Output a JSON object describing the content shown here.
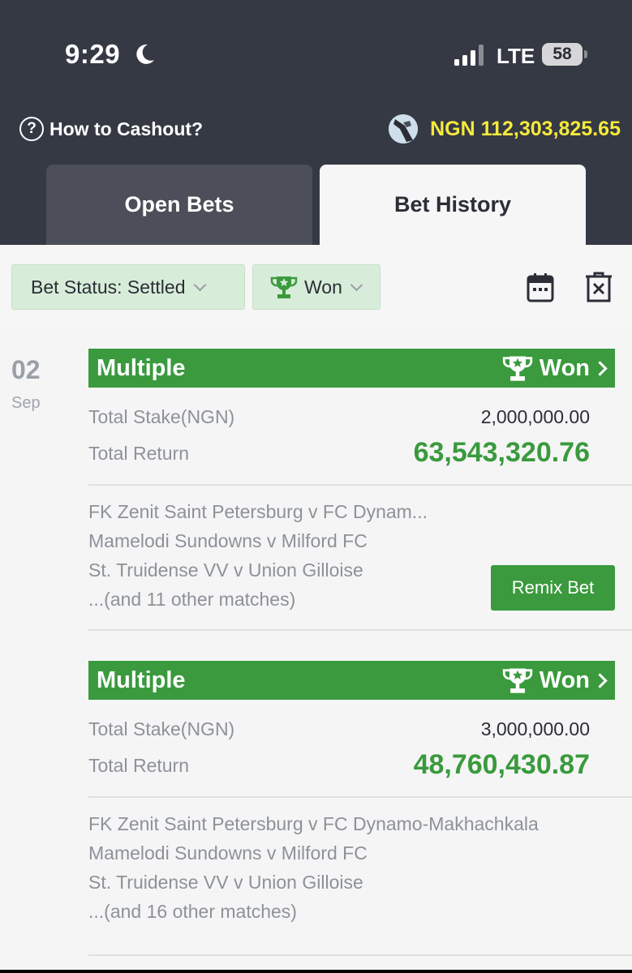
{
  "status_bar": {
    "time": "9:29",
    "network": "LTE",
    "battery": "58"
  },
  "header": {
    "help_label": "How to Cashout?",
    "balance": "NGN 112,303,825.65"
  },
  "tabs": [
    {
      "label": "Open Bets",
      "active": false
    },
    {
      "label": "Bet History",
      "active": true
    }
  ],
  "filters": {
    "status_label": "Bet Status: Settled",
    "result_label": "Won"
  },
  "date_group": {
    "day": "02",
    "month": "Sep"
  },
  "bets": [
    {
      "type": "Multiple",
      "result": "Won",
      "stake_label": "Total Stake(NGN)",
      "stake": "2,000,000.00",
      "return_label": "Total Return",
      "total_return": "63,543,320.76",
      "matches": [
        "FK Zenit Saint Petersburg v FC Dynam...",
        "Mamelodi Sundowns v Milford FC",
        "St. Truidense VV v Union Gilloise",
        "...(and 11 other matches)"
      ],
      "action_label": "Remix Bet"
    },
    {
      "type": "Multiple",
      "result": "Won",
      "stake_label": "Total Stake(NGN)",
      "stake": "3,000,000.00",
      "return_label": "Total Return",
      "total_return": "48,760,430.87",
      "matches": [
        "FK Zenit Saint Petersburg v FC Dynamo-Makhachkala",
        "Mamelodi Sundowns v Milford FC",
        "St. Truidense VV v Union Gilloise",
        "...(and 16 other matches)"
      ]
    }
  ],
  "colors": {
    "header_bg": "#353944",
    "accent_green": "#3a9a3d",
    "balance_yellow": "#f5ea3c",
    "chip_bg": "#d8edd9"
  },
  "icons": [
    "moon-icon",
    "signal-icon",
    "battery-icon",
    "help-circle-icon",
    "avatar",
    "trophy-icon",
    "chevron-down-icon",
    "calendar-icon",
    "clear-filter-icon",
    "chevron-right-icon"
  ]
}
